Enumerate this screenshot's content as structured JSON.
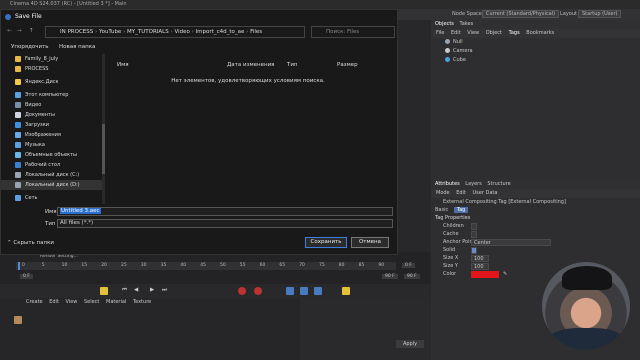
{
  "app": {
    "title": "Cinema 4D S24.037 (RC) - [Untitled 3 *] - Main"
  },
  "topbar": {
    "node_space_label": "Node Space",
    "node_space_value": "Current (Standard/Physical)",
    "layout_label": "Layout",
    "layout_value": "Startup (User)"
  },
  "objects": {
    "tabs": [
      "Objects",
      "Takes"
    ],
    "menu": [
      "File",
      "Edit",
      "View",
      "Object",
      "Tags",
      "Bookmarks"
    ],
    "items": [
      {
        "name": "Null",
        "color": "#9aa4b0"
      },
      {
        "name": "Camera",
        "color": "#c9c9c9"
      },
      {
        "name": "Cube",
        "color": "#4aa3df"
      }
    ]
  },
  "attributes": {
    "tabs": [
      "Attributes",
      "Layers",
      "Structure"
    ],
    "menu": [
      "Mode",
      "Edit",
      "User Data"
    ],
    "tag_name": "External Compositing Tag [External Compositing]",
    "subtabs": [
      "Basic",
      "Tag"
    ],
    "section": "Tag Properties",
    "rows": [
      {
        "label": "Children"
      },
      {
        "label": "Cache"
      },
      {
        "label": "Anchor Point",
        "value": "Center"
      },
      {
        "label": "Solid"
      },
      {
        "label": "Size X",
        "value": "100"
      },
      {
        "label": "Size Y",
        "value": "100"
      },
      {
        "label": "Color"
      }
    ],
    "color_swatch": "#e0161a"
  },
  "timeline": {
    "ticks": [
      "0",
      "5",
      "10",
      "15",
      "20",
      "25",
      "30",
      "35",
      "40",
      "45",
      "50",
      "55",
      "60",
      "65",
      "70",
      "75",
      "80",
      "85",
      "90"
    ],
    "render_settings": "Render Setting...",
    "current": "0 F",
    "start": "0 F",
    "end": "90 F",
    "end2": "90 F",
    "start2": "0 F"
  },
  "material": {
    "menu": [
      "Create",
      "Edit",
      "View",
      "Select",
      "Material",
      "Texture"
    ]
  },
  "coords": {
    "apply": "Apply"
  },
  "dialog": {
    "title": "Save File",
    "address": [
      "IN PROCESS",
      "YouTube",
      "MY_TUTORIALS",
      "Video",
      "Import_c4d_to_ae",
      "Files"
    ],
    "search_placeholder": "Поиск: Files",
    "organize": "Упорядочить",
    "new_folder": "Новая папка",
    "nav": [
      {
        "label": "Family_8_july",
        "color": "#e4b94a"
      },
      {
        "label": "PROCESS",
        "color": "#e4b94a"
      },
      {
        "label": "",
        "color": ""
      },
      {
        "label": "Яндекс.Диск",
        "color": "#f2c94c"
      },
      {
        "label": "",
        "color": ""
      },
      {
        "label": "Этот компьютер",
        "color": "#5aa0e0"
      },
      {
        "label": "Видео",
        "color": "#7b8ea8"
      },
      {
        "label": "Документы",
        "color": "#cfd6df"
      },
      {
        "label": "Загрузки",
        "color": "#3d8fe0"
      },
      {
        "label": "Изображения",
        "color": "#6aa8e8"
      },
      {
        "label": "Музыка",
        "color": "#5aa0e0"
      },
      {
        "label": "Объемные объекты",
        "color": "#6bb6e8"
      },
      {
        "label": "Рабочий стол",
        "color": "#3d7fd0"
      },
      {
        "label": "Локальный диск (C:)",
        "color": "#9aa4b0"
      },
      {
        "label": "Локальный диск (D:)",
        "color": "#9aa4b0"
      },
      {
        "label": "",
        "color": ""
      },
      {
        "label": "Сеть",
        "color": "#5aa0e0"
      }
    ],
    "columns": [
      "Имя",
      "Дата изменения",
      "Тип",
      "Размер"
    ],
    "empty_message": "Нет элементов, удовлетворяющих условиям поиска.",
    "filename_label": "Имя файла:",
    "filename_value": "Untitled 3.aec",
    "filetype_label": "Тип файла:",
    "filetype_value": "All files (*.*)",
    "hide_folders": "Скрыть папки",
    "save": "Сохранить",
    "cancel": "Отмена"
  }
}
